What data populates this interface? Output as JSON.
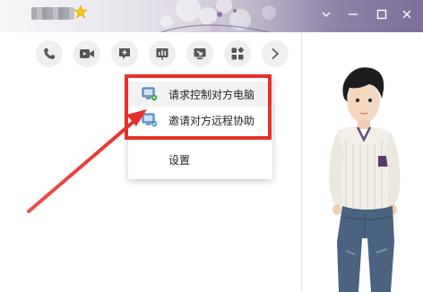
{
  "title_bar": {
    "contact_name": "",
    "buttons": [
      "minimize-button",
      "maximize-button",
      "close-button",
      "chevron-down-button"
    ]
  },
  "toolbar": {
    "buttons": [
      {
        "name": "voice-call-button",
        "icon": "phone-icon"
      },
      {
        "name": "video-call-button",
        "icon": "video-camera-icon"
      },
      {
        "name": "share-screen-button",
        "icon": "share-screen-icon"
      },
      {
        "name": "demo-whiteboard-button",
        "icon": "presentation-icon"
      },
      {
        "name": "remote-desktop-button",
        "icon": "remote-desktop-icon"
      },
      {
        "name": "apps-button",
        "icon": "apps-grid-icon"
      },
      {
        "name": "more-button",
        "icon": "chevron-right-icon"
      }
    ]
  },
  "menu": {
    "items": [
      {
        "label": "请求控制对方电脑",
        "icon": "monitor-control-icon"
      },
      {
        "label": "邀请对方远程协助",
        "icon": "monitor-assist-icon"
      },
      {
        "label": "设置"
      }
    ]
  },
  "colors": {
    "annotation_red": "#e8302b",
    "toolbar_button_bg": "#efefef",
    "menu_hover_bg": "#f2f2f2"
  }
}
